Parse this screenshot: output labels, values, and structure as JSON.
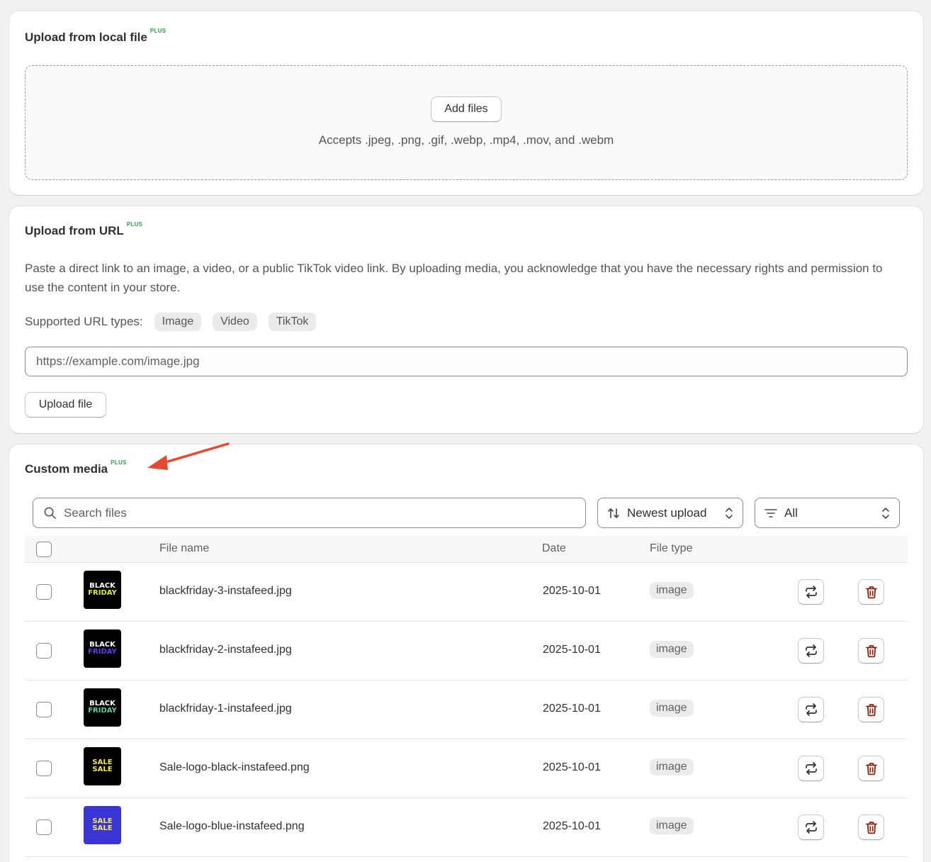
{
  "local_upload": {
    "title": "Upload from local file",
    "badge": "PLUS",
    "add_files_label": "Add files",
    "accepts_text": "Accepts .jpeg, .png, .gif, .webp, .mp4, .mov, and .webm"
  },
  "url_upload": {
    "title": "Upload from URL",
    "badge": "PLUS",
    "description": "Paste a direct link to an image, a video, or a public TikTok video link. By uploading media, you acknowledge that you have the necessary rights and permission to use the content in your store.",
    "supported_label": "Supported URL types:",
    "types": [
      "Image",
      "Video",
      "TikTok"
    ],
    "url_placeholder": "https://example.com/image.jpg",
    "upload_button_label": "Upload file"
  },
  "custom_media": {
    "title": "Custom media",
    "badge": "PLUS",
    "search_placeholder": "Search files",
    "sort_value": "Newest upload",
    "filter_value": "All",
    "columns": {
      "file_name": "File name",
      "date": "Date",
      "file_type": "File type"
    },
    "rows": [
      {
        "name": "blackfriday-3-instafeed.jpg",
        "date": "2025-10-01",
        "type": "image",
        "thumb": {
          "bg": "#000000",
          "line1": "BLACK",
          "line2": "FRIDAY",
          "color1": "#ffffff",
          "color2": "#d8f03a"
        }
      },
      {
        "name": "blackfriday-2-instafeed.jpg",
        "date": "2025-10-01",
        "type": "image",
        "thumb": {
          "bg": "#000000",
          "line1": "BLACK",
          "line2": "FRIDAY",
          "color1": "#ffffff",
          "color2": "#5b3ff0"
        }
      },
      {
        "name": "blackfriday-1-instafeed.jpg",
        "date": "2025-10-01",
        "type": "image",
        "thumb": {
          "bg": "#000000",
          "line1": "BLACK",
          "line2": "FRIDAY",
          "color1": "#ffffff",
          "color2": "#5fd08a"
        }
      },
      {
        "name": "Sale-logo-black-instafeed.png",
        "date": "2025-10-01",
        "type": "image",
        "thumb": {
          "bg": "#000000",
          "line1": "SALE",
          "line2": "SALE",
          "color1": "#f5e94a",
          "color2": "#f5e94a"
        }
      },
      {
        "name": "Sale-logo-blue-instafeed.png",
        "date": "2025-10-01",
        "type": "image",
        "thumb": {
          "bg": "#3b35d6",
          "line1": "SALE",
          "line2": "SALE",
          "color1": "#f5e94a",
          "color2": "#f5e94a"
        }
      }
    ]
  },
  "colors": {
    "plus_badge": "#29a347",
    "delete_icon": "#8e1f0b",
    "annotation_arrow": "#e5492f"
  }
}
